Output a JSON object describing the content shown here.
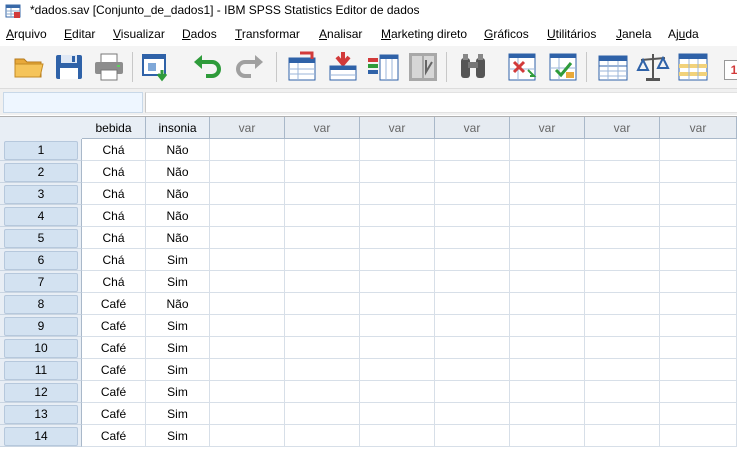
{
  "window": {
    "title": "*dados.sav [Conjunto_de_dados1] - IBM SPSS Statistics Editor de dados"
  },
  "menu": [
    {
      "label": "Arquivo",
      "mnemonic": "A",
      "rest": "rquivo"
    },
    {
      "label": "Editar",
      "mnemonic": "E",
      "rest": "ditar"
    },
    {
      "label": "Visualizar",
      "mnemonic": "V",
      "rest": "isualizar"
    },
    {
      "label": "Dados",
      "mnemonic": "D",
      "rest": "ados"
    },
    {
      "label": "Transformar",
      "mnemonic": "T",
      "rest": "ransformar"
    },
    {
      "label": "Analisar",
      "mnemonic": "A",
      "rest": "nalisar"
    },
    {
      "label": "Marketing direto",
      "mnemonic": "M",
      "rest": "arketing direto"
    },
    {
      "label": "Gráficos",
      "mnemonic": "G",
      "rest": "ráficos"
    },
    {
      "label": "Utilitários",
      "mnemonic": "U",
      "rest": "tilitários"
    },
    {
      "label": "Janela",
      "mnemonic": "J",
      "rest": "anela"
    },
    {
      "label": "Ajuda",
      "mnemonic": "A",
      "rest": "juda",
      "pre": "Aj",
      "post": "da",
      "u": "u"
    }
  ],
  "toolbar": [
    "open-folder-icon",
    "save-icon",
    "print-icon",
    "dialog-recall-icon",
    "undo-icon",
    "redo-icon",
    "go-to-case-icon",
    "go-to-variable-icon",
    "variables-icon",
    "run-descriptives-icon",
    "find-icon",
    "insert-cases-icon",
    "insert-variable-icon",
    "split-file-icon",
    "weight-cases-icon",
    "select-cases-icon"
  ],
  "toolbar_extra_label": "1",
  "columns": [
    "bebida",
    "insonia",
    "var",
    "var",
    "var",
    "var",
    "var",
    "var",
    "var"
  ],
  "rows": [
    {
      "n": "1",
      "bebida": "Chá",
      "insonia": "Não"
    },
    {
      "n": "2",
      "bebida": "Chá",
      "insonia": "Não"
    },
    {
      "n": "3",
      "bebida": "Chá",
      "insonia": "Não"
    },
    {
      "n": "4",
      "bebida": "Chá",
      "insonia": "Não"
    },
    {
      "n": "5",
      "bebida": "Chá",
      "insonia": "Não"
    },
    {
      "n": "6",
      "bebida": "Chá",
      "insonia": "Sim"
    },
    {
      "n": "7",
      "bebida": "Chá",
      "insonia": "Sim"
    },
    {
      "n": "8",
      "bebida": "Café",
      "insonia": "Não"
    },
    {
      "n": "9",
      "bebida": "Café",
      "insonia": "Sim"
    },
    {
      "n": "10",
      "bebida": "Café",
      "insonia": "Sim"
    },
    {
      "n": "11",
      "bebida": "Café",
      "insonia": "Sim"
    },
    {
      "n": "12",
      "bebida": "Café",
      "insonia": "Sim"
    },
    {
      "n": "13",
      "bebida": "Café",
      "insonia": "Sim"
    },
    {
      "n": "14",
      "bebida": "Café",
      "insonia": "Sim"
    }
  ]
}
